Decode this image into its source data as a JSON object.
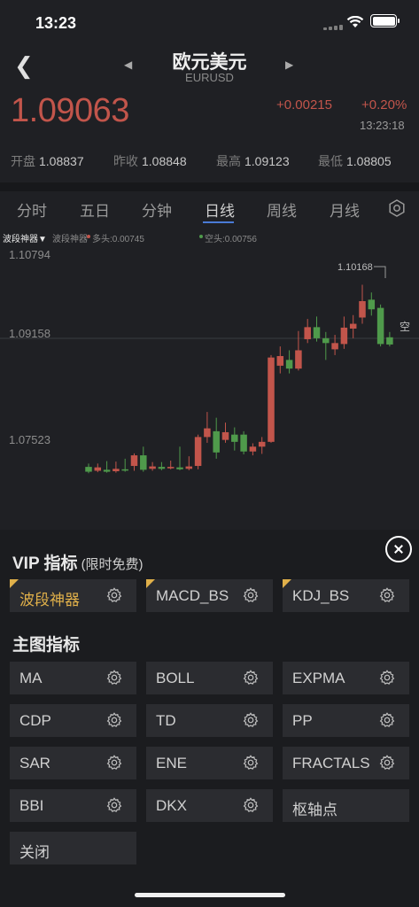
{
  "status": {
    "time": "13:23"
  },
  "nav": {
    "title": "欧元美元",
    "subtitle": "EURUSD"
  },
  "quote": {
    "price": "1.09063",
    "change": "+0.00215",
    "change_pct": "+0.20%",
    "time": "13:23:18"
  },
  "stats": [
    {
      "label": "开盘",
      "value": "1.08837"
    },
    {
      "label": "昨收",
      "value": "1.08848"
    },
    {
      "label": "最高",
      "value": "1.09123"
    },
    {
      "label": "最低",
      "value": "1.08805"
    }
  ],
  "tabs": [
    "分时",
    "五日",
    "分钟",
    "日线",
    "周线",
    "月线"
  ],
  "active_tab": "日线",
  "legend": {
    "indicator": "波段神器▼",
    "name": "波段神器",
    "long": "多头:0.00745",
    "short": "空头:0.00756"
  },
  "chart": {
    "y_labels": [
      "1.10794",
      "1.09158",
      "1.07523"
    ],
    "high_label": "1.10168",
    "marker": "空",
    "candles": [
      {
        "o": 1.0638,
        "c": 1.0628,
        "h": 1.0645,
        "l": 1.0625
      },
      {
        "o": 1.063,
        "c": 1.0637,
        "h": 1.0645,
        "l": 1.0627
      },
      {
        "o": 1.0632,
        "c": 1.0628,
        "h": 1.065,
        "l": 1.0626
      },
      {
        "o": 1.0629,
        "c": 1.0634,
        "h": 1.0649,
        "l": 1.0626
      },
      {
        "o": 1.0633,
        "c": 1.0631,
        "h": 1.0655,
        "l": 1.0628
      },
      {
        "o": 1.064,
        "c": 1.0662,
        "h": 1.0666,
        "l": 1.063
      },
      {
        "o": 1.0662,
        "c": 1.0632,
        "h": 1.068,
        "l": 1.0628
      },
      {
        "o": 1.0634,
        "c": 1.0639,
        "h": 1.0648,
        "l": 1.063
      },
      {
        "o": 1.0638,
        "c": 1.0634,
        "h": 1.0648,
        "l": 1.0631
      },
      {
        "o": 1.0635,
        "c": 1.0638,
        "h": 1.0651,
        "l": 1.0633
      },
      {
        "o": 1.0637,
        "c": 1.0633,
        "h": 1.068,
        "l": 1.0631
      },
      {
        "o": 1.0634,
        "c": 1.0639,
        "h": 1.066,
        "l": 1.0631
      },
      {
        "o": 1.064,
        "c": 1.07,
        "h": 1.0705,
        "l": 1.0633
      },
      {
        "o": 1.07,
        "c": 1.0718,
        "h": 1.0752,
        "l": 1.0688
      },
      {
        "o": 1.0712,
        "c": 1.0668,
        "h": 1.074,
        "l": 1.0655
      },
      {
        "o": 1.0694,
        "c": 1.071,
        "h": 1.073,
        "l": 1.0688
      },
      {
        "o": 1.0705,
        "c": 1.069,
        "h": 1.072,
        "l": 1.0672
      },
      {
        "o": 1.0705,
        "c": 1.067,
        "h": 1.0712,
        "l": 1.0664
      },
      {
        "o": 1.067,
        "c": 1.068,
        "h": 1.0687,
        "l": 1.0662
      },
      {
        "o": 1.068,
        "c": 1.069,
        "h": 1.07,
        "l": 1.0665
      },
      {
        "o": 1.069,
        "c": 1.0865,
        "h": 1.087,
        "l": 1.0688
      },
      {
        "o": 1.0848,
        "c": 1.0868,
        "h": 1.0888,
        "l": 1.0832
      },
      {
        "o": 1.086,
        "c": 1.0842,
        "h": 1.088,
        "l": 1.0832
      },
      {
        "o": 1.0842,
        "c": 1.088,
        "h": 1.092,
        "l": 1.0838
      },
      {
        "o": 1.0903,
        "c": 1.0928,
        "h": 1.0945,
        "l": 1.0895
      },
      {
        "o": 1.0928,
        "c": 1.0905,
        "h": 1.095,
        "l": 1.0898
      },
      {
        "o": 1.0905,
        "c": 1.0895,
        "h": 1.0918,
        "l": 1.086
      },
      {
        "o": 1.0882,
        "c": 1.0895,
        "h": 1.0912,
        "l": 1.087
      },
      {
        "o": 1.0893,
        "c": 1.0927,
        "h": 1.095,
        "l": 1.0883
      },
      {
        "o": 1.0925,
        "c": 1.0935,
        "h": 1.0953,
        "l": 1.0905
      },
      {
        "o": 1.0948,
        "c": 1.0982,
        "h": 1.1016,
        "l": 1.0935
      },
      {
        "o": 1.0985,
        "c": 1.0965,
        "h": 1.1,
        "l": 1.0952
      },
      {
        "o": 1.0968,
        "c": 1.0893,
        "h": 1.0975,
        "l": 1.0888
      },
      {
        "o": 1.0907,
        "c": 1.0892,
        "h": 1.0918,
        "l": 1.0888
      }
    ]
  },
  "panel": {
    "vip_title": "VIP 指标",
    "vip_note": "(限时免费)",
    "vip_items": [
      "波段神器",
      "MACD_BS",
      "KDJ_BS"
    ],
    "main_title": "主图指标",
    "main_items": [
      {
        "label": "MA",
        "gear": true
      },
      {
        "label": "BOLL",
        "gear": true
      },
      {
        "label": "EXPMA",
        "gear": true
      },
      {
        "label": "CDP",
        "gear": true
      },
      {
        "label": "TD",
        "gear": true
      },
      {
        "label": "PP",
        "gear": true
      },
      {
        "label": "SAR",
        "gear": true
      },
      {
        "label": "ENE",
        "gear": true
      },
      {
        "label": "FRACTALS",
        "gear": true
      },
      {
        "label": "BBI",
        "gear": true
      },
      {
        "label": "DKX",
        "gear": true
      },
      {
        "label": "枢轴点",
        "gear": false
      },
      {
        "label": "关闭",
        "gear": false
      }
    ]
  },
  "colors": {
    "up": "#c2554b",
    "down": "#4f9a4b",
    "vip": "#e0b04a",
    "accent": "#4a7bd6"
  }
}
